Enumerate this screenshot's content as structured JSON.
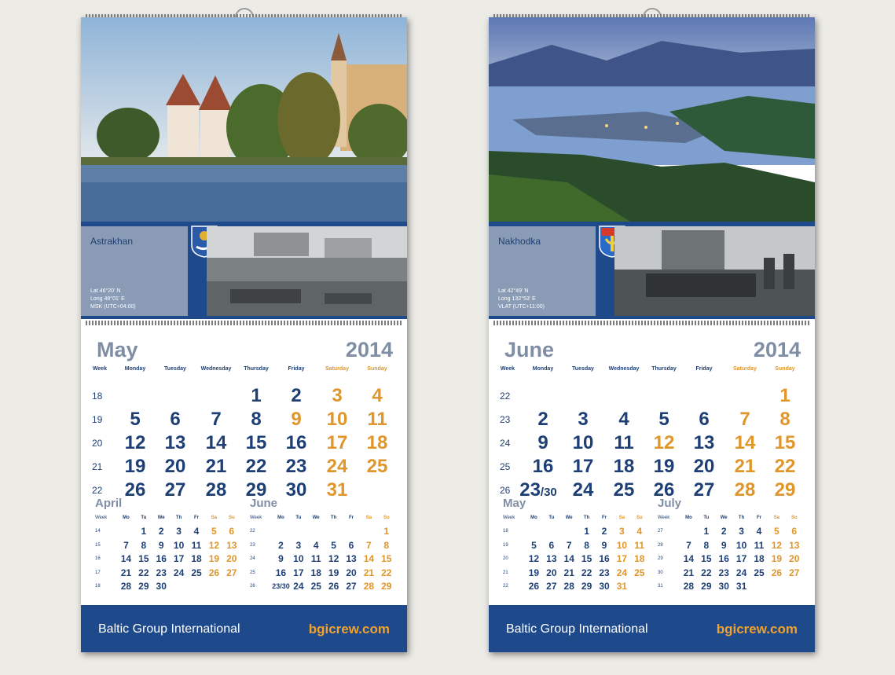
{
  "calendars": [
    {
      "city": "Astrakhan",
      "lat": "Lat 46°20' N",
      "long": "Long 48°01' E",
      "tz": "MSK (UTC+04:00)",
      "month": "May",
      "year": "2014",
      "weekday_headers": [
        "Week",
        "Monday",
        "Tuesday",
        "Wednesday",
        "Thursday",
        "Friday",
        "Saturday",
        "Sunday"
      ],
      "weeks": [
        {
          "wk": "18",
          "days": [
            "",
            "",
            "",
            "1",
            "2",
            "3",
            "4"
          ]
        },
        {
          "wk": "19",
          "days": [
            "5",
            "6",
            "7",
            "8",
            "9",
            "10",
            "11"
          ]
        },
        {
          "wk": "20",
          "days": [
            "12",
            "13",
            "14",
            "15",
            "16",
            "17",
            "18"
          ]
        },
        {
          "wk": "21",
          "days": [
            "19",
            "20",
            "21",
            "22",
            "23",
            "24",
            "25"
          ]
        },
        {
          "wk": "22",
          "days": [
            "26",
            "27",
            "28",
            "29",
            "30",
            "31",
            ""
          ]
        }
      ],
      "weekend_days": [
        "9"
      ],
      "mini": [
        {
          "title": "April",
          "head": [
            "Week",
            "Mo",
            "Tu",
            "We",
            "Th",
            "Fr",
            "Sa",
            "Su"
          ],
          "rows": [
            {
              "wk": "14",
              "days": [
                "",
                "1",
                "2",
                "3",
                "4",
                "5",
                "6"
              ]
            },
            {
              "wk": "15",
              "days": [
                "7",
                "8",
                "9",
                "10",
                "11",
                "12",
                "13"
              ]
            },
            {
              "wk": "16",
              "days": [
                "14",
                "15",
                "16",
                "17",
                "18",
                "19",
                "20"
              ]
            },
            {
              "wk": "17",
              "days": [
                "21",
                "22",
                "23",
                "24",
                "25",
                "26",
                "27"
              ]
            },
            {
              "wk": "18",
              "days": [
                "28",
                "29",
                "30",
                "",
                "",
                "",
                ""
              ]
            }
          ]
        },
        {
          "title": "June",
          "head": [
            "Week",
            "Mo",
            "Tu",
            "We",
            "Th",
            "Fr",
            "Sa",
            "Su"
          ],
          "rows": [
            {
              "wk": "22",
              "days": [
                "",
                "",
                "",
                "",
                "",
                "",
                "1"
              ]
            },
            {
              "wk": "23",
              "days": [
                "2",
                "3",
                "4",
                "5",
                "6",
                "7",
                "8"
              ]
            },
            {
              "wk": "24",
              "days": [
                "9",
                "10",
                "11",
                "12",
                "13",
                "14",
                "15"
              ]
            },
            {
              "wk": "25",
              "days": [
                "16",
                "17",
                "18",
                "19",
                "20",
                "21",
                "22"
              ]
            },
            {
              "wk": "26",
              "days": [
                "23/30",
                "24",
                "25",
                "26",
                "27",
                "28",
                "29"
              ]
            }
          ]
        }
      ],
      "company": "Baltic Group International",
      "site": "bgicrew.com"
    },
    {
      "city": "Nakhodka",
      "lat": "Lat 42°49' N",
      "long": "Long 132°53' E",
      "tz": "VLAT (UTC+11:00)",
      "month": "June",
      "year": "2014",
      "weekday_headers": [
        "Week",
        "Monday",
        "Tuesday",
        "Wednesday",
        "Thursday",
        "Friday",
        "Saturday",
        "Sunday"
      ],
      "weeks": [
        {
          "wk": "22",
          "days": [
            "",
            "",
            "",
            "",
            "",
            "",
            "1"
          ]
        },
        {
          "wk": "23",
          "days": [
            "2",
            "3",
            "4",
            "5",
            "6",
            "7",
            "8"
          ]
        },
        {
          "wk": "24",
          "days": [
            "9",
            "10",
            "11",
            "12",
            "13",
            "14",
            "15"
          ]
        },
        {
          "wk": "25",
          "days": [
            "16",
            "17",
            "18",
            "19",
            "20",
            "21",
            "22"
          ]
        },
        {
          "wk": "26",
          "days": [
            "23/30",
            "24",
            "25",
            "26",
            "27",
            "28",
            "29"
          ]
        }
      ],
      "weekend_days": [
        "12"
      ],
      "mini": [
        {
          "title": "May",
          "head": [
            "Week",
            "Mo",
            "Tu",
            "We",
            "Th",
            "Fr",
            "Sa",
            "Su"
          ],
          "rows": [
            {
              "wk": "18",
              "days": [
                "",
                "",
                "",
                "1",
                "2",
                "3",
                "4"
              ]
            },
            {
              "wk": "19",
              "days": [
                "5",
                "6",
                "7",
                "8",
                "9",
                "10",
                "11"
              ]
            },
            {
              "wk": "20",
              "days": [
                "12",
                "13",
                "14",
                "15",
                "16",
                "17",
                "18"
              ]
            },
            {
              "wk": "21",
              "days": [
                "19",
                "20",
                "21",
                "22",
                "23",
                "24",
                "25"
              ]
            },
            {
              "wk": "22",
              "days": [
                "26",
                "27",
                "28",
                "29",
                "30",
                "31",
                ""
              ]
            }
          ]
        },
        {
          "title": "July",
          "head": [
            "Week",
            "Mo",
            "Tu",
            "We",
            "Th",
            "Fr",
            "Sa",
            "Su"
          ],
          "rows": [
            {
              "wk": "27",
              "days": [
                "",
                "1",
                "2",
                "3",
                "4",
                "5",
                "6"
              ]
            },
            {
              "wk": "28",
              "days": [
                "7",
                "8",
                "9",
                "10",
                "11",
                "12",
                "13"
              ]
            },
            {
              "wk": "29",
              "days": [
                "14",
                "15",
                "16",
                "17",
                "18",
                "19",
                "20"
              ]
            },
            {
              "wk": "30",
              "days": [
                "21",
                "22",
                "23",
                "24",
                "25",
                "26",
                "27"
              ]
            },
            {
              "wk": "31",
              "days": [
                "28",
                "29",
                "30",
                "31",
                "",
                "",
                ""
              ]
            }
          ]
        }
      ],
      "company": "Baltic Group International",
      "site": "bgicrew.com"
    }
  ],
  "colors": {
    "navy": "#1e3f75",
    "orange": "#e0962a",
    "grey": "#7f8ea4",
    "band": "#1e4a8c"
  }
}
